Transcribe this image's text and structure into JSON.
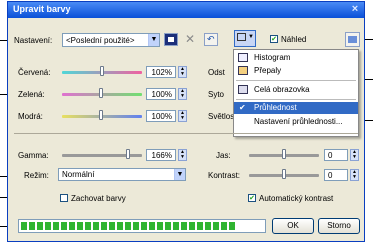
{
  "dialog": {
    "title": "Upravit barvy",
    "close_label": "×"
  },
  "settings": {
    "label": "Nastavení:",
    "value": "<Poslední použité>"
  },
  "preview": {
    "label": "Náhled",
    "checked": true
  },
  "sliders": {
    "red": {
      "label": "Červená:",
      "value": "102%",
      "level": 0.51
    },
    "green": {
      "label": "Zelená:",
      "value": "100%",
      "level": 0.5
    },
    "blue": {
      "label": "Modrá:",
      "value": "100%",
      "level": 0.5
    },
    "hidden_right": [
      "Odst",
      "Syto",
      "Světlos"
    ],
    "gamma": {
      "label": "Gamma:",
      "value": "166%",
      "level": 0.86
    },
    "brightness": {
      "label": "Jas:",
      "value": "0",
      "level": 0.5
    },
    "contrast": {
      "label": "Kontrast:",
      "value": "0",
      "level": 0.5
    }
  },
  "mode": {
    "label": "Režim:",
    "value": "Normální"
  },
  "preserve_colors": {
    "label": "Zachovat barvy",
    "checked": false
  },
  "auto_contrast": {
    "label": "Automatický kontrast",
    "checked": true
  },
  "menu": {
    "items": [
      {
        "label": "Histogram",
        "icon": "histogram-icon"
      },
      {
        "label": "Přepaly",
        "icon": "overexposure-icon"
      },
      {
        "label": "Celá obrazovka",
        "icon": "monitor-icon"
      },
      {
        "label": "Průhlednost",
        "checked": true,
        "highlighted": true
      },
      {
        "label": "Nastavení průhlednosti..."
      }
    ]
  },
  "progress": {
    "level": 0.87
  },
  "buttons": {
    "ok": "OK",
    "cancel": "Storno"
  },
  "colors": {
    "accent": "#316AC5",
    "progress": "#2FB431",
    "title": "#0A50D8"
  }
}
